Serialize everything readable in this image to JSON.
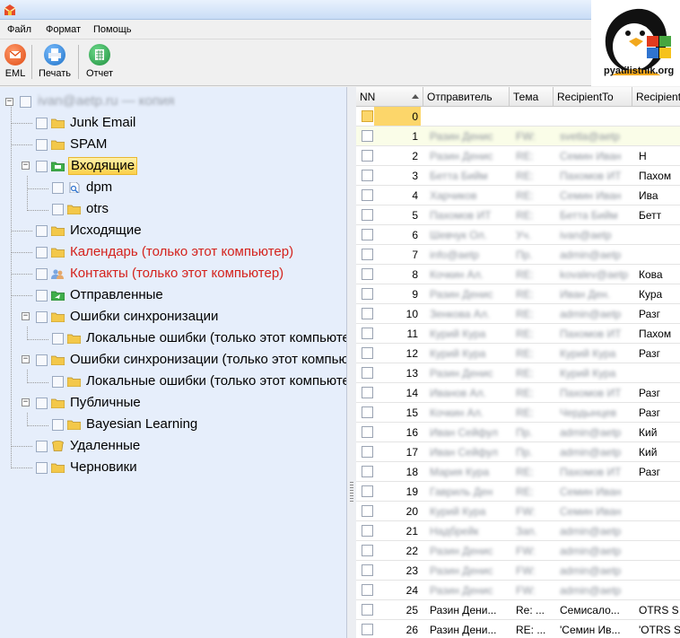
{
  "menu": {
    "file": "Файл",
    "format": "Формат",
    "help": "Помощь"
  },
  "toolbar": {
    "eml": "EML",
    "print": "Печать",
    "report": "Отчет"
  },
  "watermark": {
    "text": "pyatilistnik.org"
  },
  "tree": {
    "root": "ivan@aetp.ru — копия",
    "items": [
      "Junk Email",
      "SPAM",
      "Входящие",
      "dpm",
      "otrs",
      "Исходящие",
      "Календарь (только этот компьютер)",
      "Контакты (только этот компьютер)",
      "Отправленные",
      "Ошибки синхронизации",
      "Локальные ошибки (только этот компьютер)",
      "Ошибки синхронизации (только этот компьютер)",
      "Локальные ошибки (только этот компьютер)",
      "Публичные",
      "Bayesian Learning",
      "Удаленные",
      "Черновики"
    ]
  },
  "grid": {
    "columns": [
      "NN",
      "Отправитель",
      "Тема",
      "RecipientTo",
      "Recipient"
    ],
    "rows": [
      {
        "nn": "0",
        "from": "",
        "subj": "",
        "to": "",
        "to2": ""
      },
      {
        "nn": "1",
        "from": "Разин Денис",
        "subj": "FW:",
        "to": "svetla@aetp",
        "to2": ""
      },
      {
        "nn": "2",
        "from": "Разин Денис",
        "subj": "RE:",
        "to": "Семин Иван",
        "to2": "Н"
      },
      {
        "nn": "3",
        "from": "Бетта Бийм",
        "subj": "RE:",
        "to": "Пахомов ИТ",
        "to2": "Пахом"
      },
      {
        "nn": "4",
        "from": "Харчиков",
        "subj": "RE:",
        "to": "Семин Иван",
        "to2": "Ива"
      },
      {
        "nn": "5",
        "from": "Пахомов ИТ",
        "subj": "RE:",
        "to": "Бетта Бийм",
        "to2": "Бетт"
      },
      {
        "nn": "6",
        "from": "Шевчук Ол.",
        "subj": "Уч.",
        "to": "ivan@aetp",
        "to2": ""
      },
      {
        "nn": "7",
        "from": "info@aetp",
        "subj": "Пр.",
        "to": "admin@aetp",
        "to2": ""
      },
      {
        "nn": "8",
        "from": "Кочкин Ал.",
        "subj": "RE:",
        "to": "kovalev@aetp",
        "to2": "Кова"
      },
      {
        "nn": "9",
        "from": "Разин Денис",
        "subj": "RE:",
        "to": "Иван Ден.",
        "to2": "Кура"
      },
      {
        "nn": "10",
        "from": "Зенкова Ал.",
        "subj": "RE:",
        "to": "admin@aetp",
        "to2": "Разг"
      },
      {
        "nn": "11",
        "from": "Курий Кура",
        "subj": "RE:",
        "to": "Пахомов ИТ",
        "to2": "Пахом"
      },
      {
        "nn": "12",
        "from": "Курий Кура",
        "subj": "RE:",
        "to": "Курий Кура",
        "to2": "Разг"
      },
      {
        "nn": "13",
        "from": "Разин Денис",
        "subj": "RE:",
        "to": "Курий Кура",
        "to2": ""
      },
      {
        "nn": "14",
        "from": "Иванов Ал.",
        "subj": "RE:",
        "to": "Пахомов ИТ",
        "to2": "Разг"
      },
      {
        "nn": "15",
        "from": "Кочкин Ал.",
        "subj": "RE:",
        "to": "Чердынцев",
        "to2": "Разг"
      },
      {
        "nn": "16",
        "from": "Иван Сейфул",
        "subj": "Пр.",
        "to": "admin@aetp",
        "to2": "Кий"
      },
      {
        "nn": "17",
        "from": "Иван Сейфул",
        "subj": "Пр.",
        "to": "admin@aetp",
        "to2": "Кий"
      },
      {
        "nn": "18",
        "from": "Мария Кура",
        "subj": "RE:",
        "to": "Пахомов ИТ",
        "to2": "Разг"
      },
      {
        "nn": "19",
        "from": "Гавриль Ден",
        "subj": "RE:",
        "to": "Семин Иван",
        "to2": ""
      },
      {
        "nn": "20",
        "from": "Курий Кура",
        "subj": "FW:",
        "to": "Семин Иван",
        "to2": ""
      },
      {
        "nn": "21",
        "from": "Надбрейк",
        "subj": "Зап.",
        "to": "admin@aetp",
        "to2": ""
      },
      {
        "nn": "22",
        "from": "Разин Денис",
        "subj": "FW:",
        "to": "admin@aetp",
        "to2": ""
      },
      {
        "nn": "23",
        "from": "Разин Денис",
        "subj": "FW:",
        "to": "admin@aetp",
        "to2": ""
      },
      {
        "nn": "24",
        "from": "Разин Денис",
        "subj": "FW:",
        "to": "admin@aetp",
        "to2": ""
      },
      {
        "nn": "25",
        "from": "Разин Дени...",
        "subj": "Re: ...",
        "to": "Семисало...",
        "to2": "OTRS S"
      },
      {
        "nn": "26",
        "from": "Разин Дени...",
        "subj": "RE: ...",
        "to": "'Семин Ив...",
        "to2": "'OTRS S"
      }
    ]
  }
}
